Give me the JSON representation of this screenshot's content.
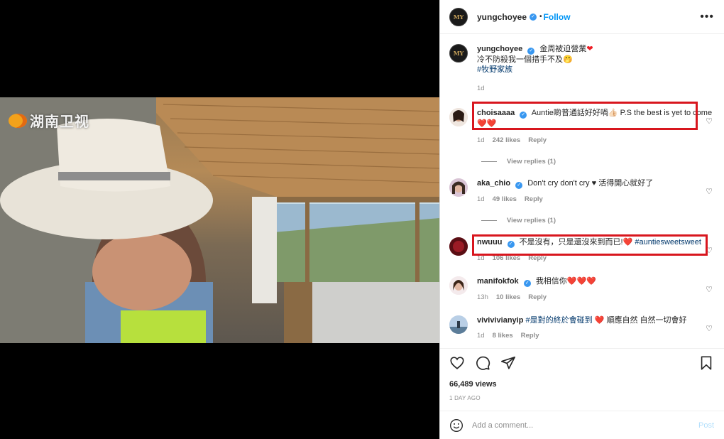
{
  "media": {
    "channel_logo_text": "湖南卫视"
  },
  "post": {
    "username": "yungchoyee",
    "follow_label": "Follow",
    "more_label": "•••",
    "caption": {
      "line1": "金周被迫營業",
      "line2": "冷不防殺我一個措手不及🤭",
      "hashtag": "#牧野家族",
      "time": "1d"
    }
  },
  "comments": [
    {
      "user": "choisaaaa",
      "text": "Auntie啲普通話好好喎👍🏻 P.S the best is yet to come",
      "hearts": "❤️❤️",
      "time": "1d",
      "likes": "242 likes",
      "reply": "Reply",
      "view_replies": "View replies (1)"
    },
    {
      "user": "aka_chio",
      "text": "Don't cry don't cry ♥ 活得開心就好了",
      "time": "1d",
      "likes": "49 likes",
      "reply": "Reply",
      "view_replies": "View replies (1)"
    },
    {
      "user": "nwuuu",
      "text": "不是沒有，只是還沒來到而已!",
      "hearts": "❤️",
      "hashtag": "#auntiesweetsweet",
      "time": "1d",
      "likes": "106 likes",
      "reply": "Reply"
    },
    {
      "user": "manifokfok",
      "text": "我相信你",
      "hearts": "❤️❤️❤️",
      "time": "13h",
      "likes": "10 likes",
      "reply": "Reply"
    },
    {
      "user": "vivivivianyip",
      "hashtag": "#是對的終於會碰到",
      "text": "順應自然 自然一切會好",
      "hearts": "❤️",
      "time": "1d",
      "likes": "8 likes",
      "reply": "Reply"
    }
  ],
  "stats": {
    "views": "66,489 views",
    "ago": "1 DAY AGO"
  },
  "add_comment": {
    "placeholder": "Add a comment...",
    "post_label": "Post"
  },
  "colors": {
    "link_blue": "#0095f6",
    "verified": "#3897f0",
    "highlight_red": "#d8161e",
    "heart_red": "#ed1c24"
  },
  "icons": [
    "more-options-icon",
    "verified-icon",
    "heart-icon",
    "comment-icon",
    "share-icon",
    "bookmark-icon",
    "emoji-icon"
  ]
}
